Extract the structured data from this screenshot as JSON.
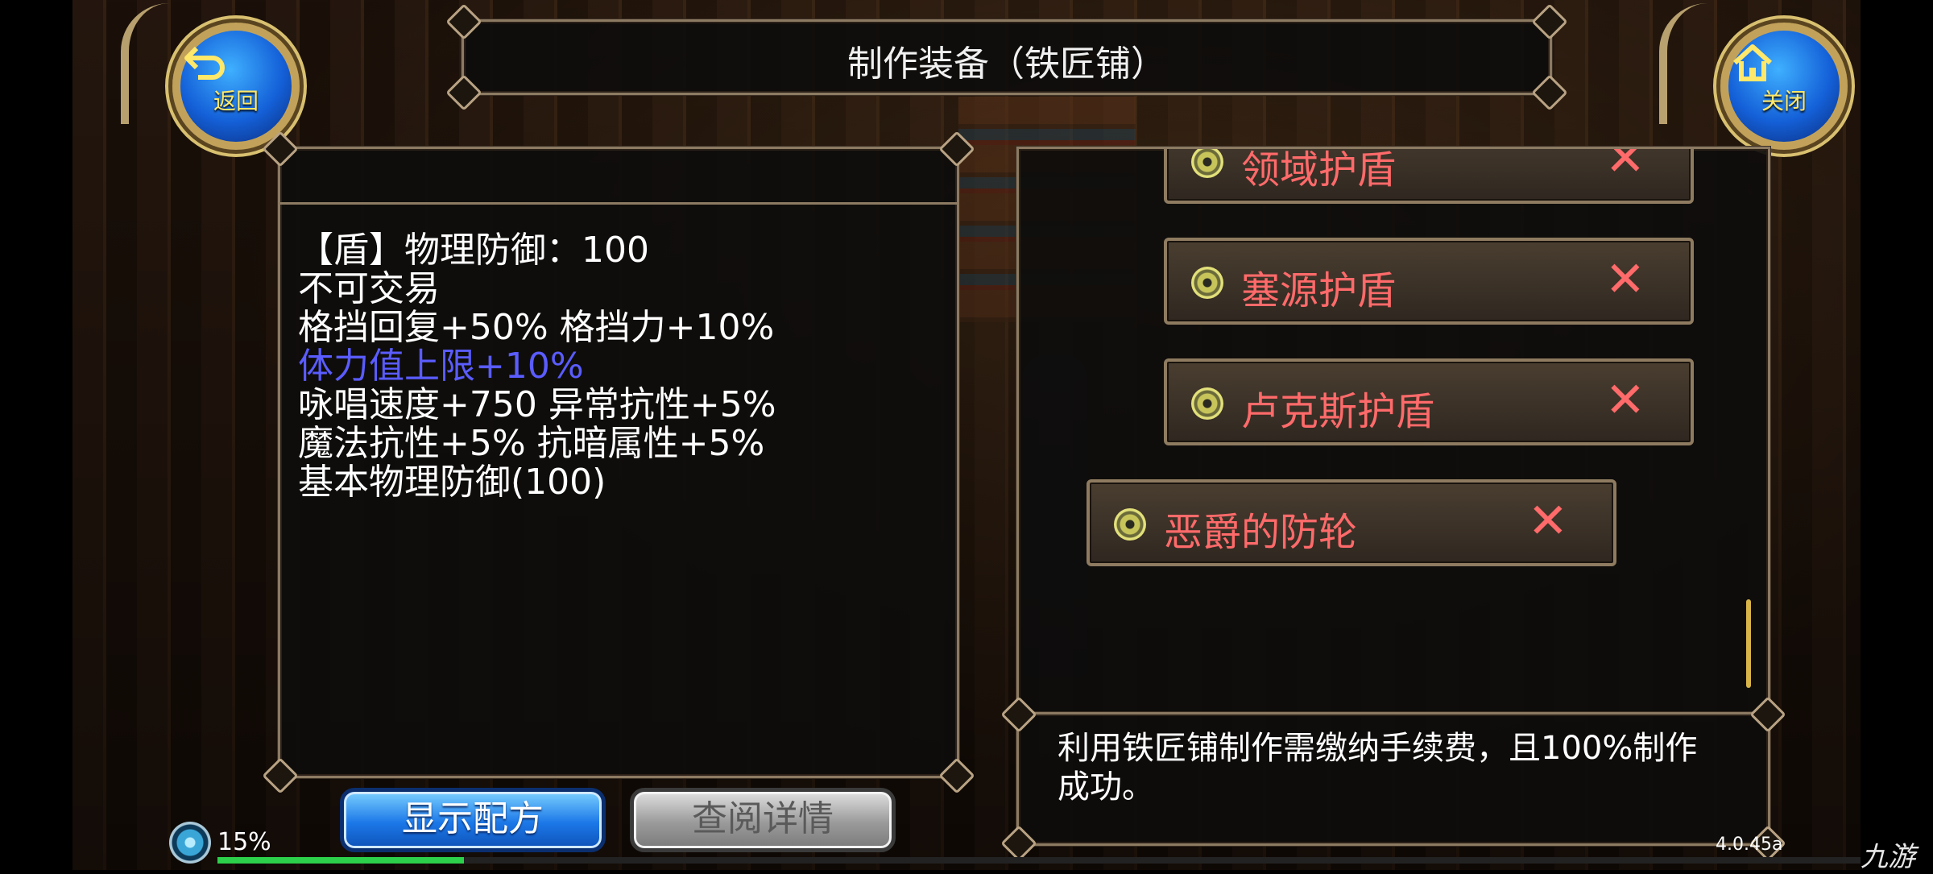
{
  "title": "制作装备（铁匠铺）",
  "back_button": {
    "label": "返回"
  },
  "close_button": {
    "label": "关闭"
  },
  "item_details": [
    "【盾】物理防御：100",
    "不可交易",
    "格挡回复+50% 格挡力+10%",
    "体力值上限+10%",
    "咏唱速度+750 异常抗性+5%",
    "魔法抗性+5% 抗暗属性+5%",
    "基本物理防御(100)"
  ],
  "item_list": [
    {
      "name": "领域护盾",
      "unavailable_mark": "✕"
    },
    {
      "name": "塞源护盾",
      "unavailable_mark": "✕"
    },
    {
      "name": "卢克斯护盾",
      "unavailable_mark": "✕"
    },
    {
      "name": "恶爵的防轮",
      "unavailable_mark": "✕"
    }
  ],
  "info_text": "利用铁匠铺制作需缴纳手续费，且100%制作成功。",
  "buttons": {
    "show_recipe": "显示配方",
    "view_details": "查阅详情"
  },
  "exp": {
    "percent_label": "15%",
    "fraction": 0.15
  },
  "version": "4.0.45a",
  "watermark": "九游",
  "colors": {
    "stat_highlight": "#5a5cff",
    "unavailable_item": "#ff6a6a",
    "exp_bar": "#2cd04a"
  }
}
